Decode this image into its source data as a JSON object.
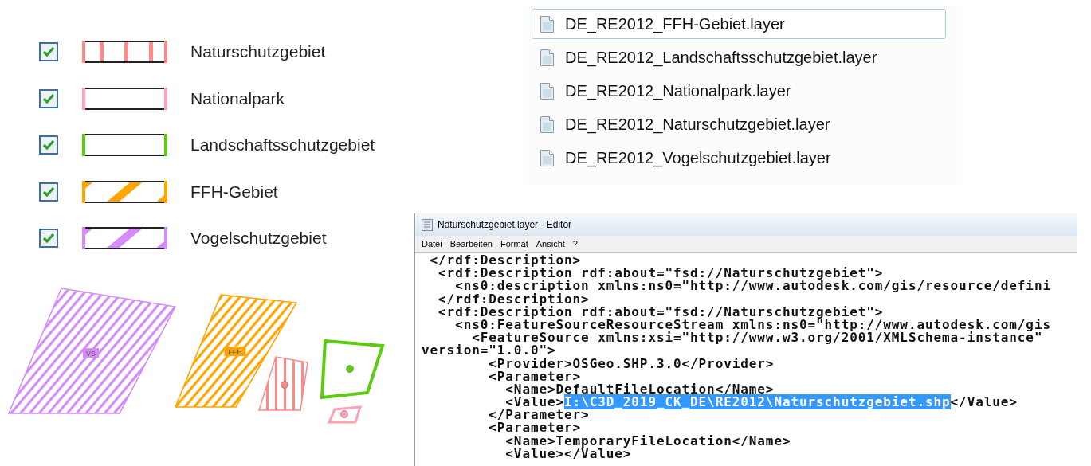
{
  "legend": [
    {
      "label": "Naturschutzgebiet",
      "checked": true,
      "color": "#ff8a8a",
      "kind": "vertical"
    },
    {
      "label": "Nationalpark",
      "checked": true,
      "color": "#ffa0b4",
      "kind": "plain"
    },
    {
      "label": "Landschaftsschutzgebiet",
      "checked": true,
      "color": "#5ccc10",
      "kind": "plain"
    },
    {
      "label": "FFH-Gebiet",
      "checked": true,
      "color": "#ffa500",
      "kind": "diagonal"
    },
    {
      "label": "Vogelschutzgebiet",
      "checked": true,
      "color": "#d48cf8",
      "kind": "diagonal"
    }
  ],
  "map": {
    "features": [
      {
        "label": "VS",
        "color": "#d48cf8",
        "kind": "diagonal"
      },
      {
        "label": "FFH",
        "color": "#ffa500",
        "kind": "diagonal"
      },
      {
        "color": "#ff8a8a",
        "kind": "vertical"
      },
      {
        "color": "#5ccc10",
        "kind": "plain"
      },
      {
        "color": "#ffa0b4",
        "kind": "plain"
      }
    ]
  },
  "files": [
    {
      "name": "DE_RE2012_FFH-Gebiet.layer",
      "selected": true
    },
    {
      "name": "DE_RE2012_Landschaftsschutzgebiet.layer",
      "selected": false
    },
    {
      "name": "DE_RE2012_Nationalpark.layer",
      "selected": false
    },
    {
      "name": "DE_RE2012_Naturschutzgebiet.layer",
      "selected": false
    },
    {
      "name": "DE_RE2012_Vogelschutzgebiet.layer",
      "selected": false
    }
  ],
  "editor": {
    "title": "Naturschutzgebiet.layer - Editor",
    "menu": [
      "Datei",
      "Bearbeiten",
      "Format",
      "Ansicht",
      "?"
    ],
    "lines": [
      {
        "text": " </rdf:Description>"
      },
      {
        "text": "  <rdf:Description rdf:about=\"fsd://Naturschutzgebiet\">"
      },
      {
        "text": "    <ns0:description xmlns:ns0=\"http://www.autodesk.com/gis/resource/defini"
      },
      {
        "text": "  </rdf:Description>"
      },
      {
        "text": "  <rdf:Description rdf:about=\"fsd://Naturschutzgebiet\">"
      },
      {
        "text": "    <ns0:FeatureSourceResourceStream xmlns:ns0=\"http://www.autodesk.com/gis"
      },
      {
        "text": "      <FeatureSource xmlns:xsi=\"http://www.w3.org/2001/XMLSchema-instance\""
      },
      {
        "text": "version=\"1.0.0\">"
      },
      {
        "text": "        <Provider>OSGeo.SHP.3.0</Provider>"
      },
      {
        "text": "        <Parameter>"
      },
      {
        "text": "          <Name>DefaultFileLocation</Name>"
      },
      {
        "text": "          <Value>",
        "highlight": "I:\\C3D_2019_CK_DE\\RE2012\\Naturschutzgebiet.shp",
        "rest": "</Value>"
      },
      {
        "text": "        </Parameter>"
      },
      {
        "text": "        <Parameter>"
      },
      {
        "text": "          <Name>TemporaryFileLocation</Name>"
      },
      {
        "text": "          <Value></Value>"
      }
    ]
  }
}
